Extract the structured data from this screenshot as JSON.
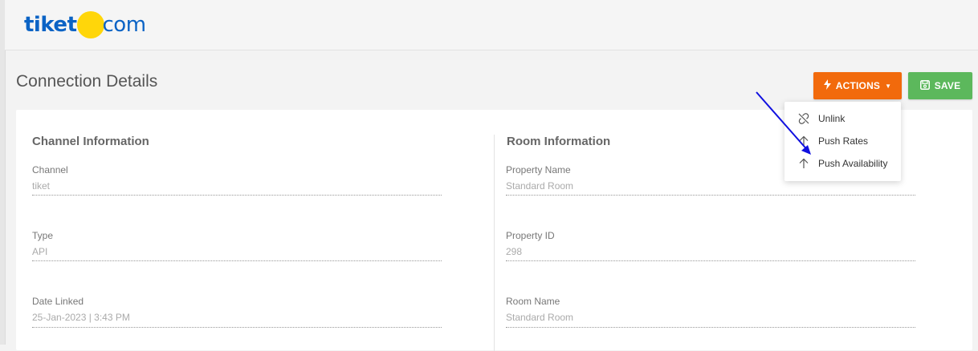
{
  "brand": {
    "logo_left": "tiket",
    "logo_right": "com"
  },
  "page": {
    "title": "Connection Details"
  },
  "toolbar": {
    "actions_label": "ACTIONS",
    "save_label": "SAVE"
  },
  "actions_menu": {
    "items": [
      {
        "label": "Unlink",
        "icon": "unlink-icon"
      },
      {
        "label": "Push Rates",
        "icon": "arrow-up-icon"
      },
      {
        "label": "Push Availability",
        "icon": "arrow-up-icon"
      }
    ]
  },
  "channel_info": {
    "title": "Channel Information",
    "fields": [
      {
        "label": "Channel",
        "value": "tiket"
      },
      {
        "label": "Type",
        "value": "API"
      },
      {
        "label": "Date Linked",
        "value": "25-Jan-2023 | 3:43 PM"
      }
    ]
  },
  "room_info": {
    "title": "Room Information",
    "fields": [
      {
        "label": "Property Name",
        "value": "Standard Room"
      },
      {
        "label": "Property ID",
        "value": "298"
      },
      {
        "label": "Room Name",
        "value": "Standard Room"
      }
    ]
  },
  "colors": {
    "actions": "#f26a0c",
    "save": "#5cb85c",
    "brand_blue": "#0b63c5",
    "brand_yellow": "#ffd60a",
    "annotation_arrow": "#1010e0"
  }
}
